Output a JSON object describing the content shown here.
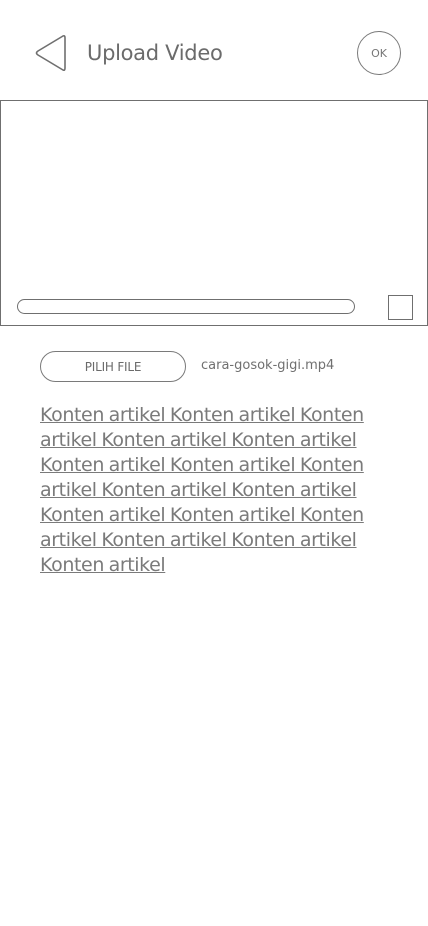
{
  "header": {
    "title": "Upload Video",
    "back_icon": "chevron-left-icon",
    "ok_label": "OK"
  },
  "player": {
    "progress": 0,
    "fullscreen_icon": "square-icon"
  },
  "file_picker": {
    "button_label": "PILIH FILE",
    "filename": "cara-gosok-gigi.mp4"
  },
  "article": {
    "content": "Konten artikel Konten artikel Konten artikel Konten artikel Konten artikel Konten artikel Konten artikel Konten artikel Konten artikel Konten artikel Konten artikel Konten artikel Konten artikel Konten artikel Konten artikel Konten artikel"
  },
  "colors": {
    "stroke": "#6f6f6f",
    "text": "#6b6b6b",
    "background": "#ffffff"
  }
}
